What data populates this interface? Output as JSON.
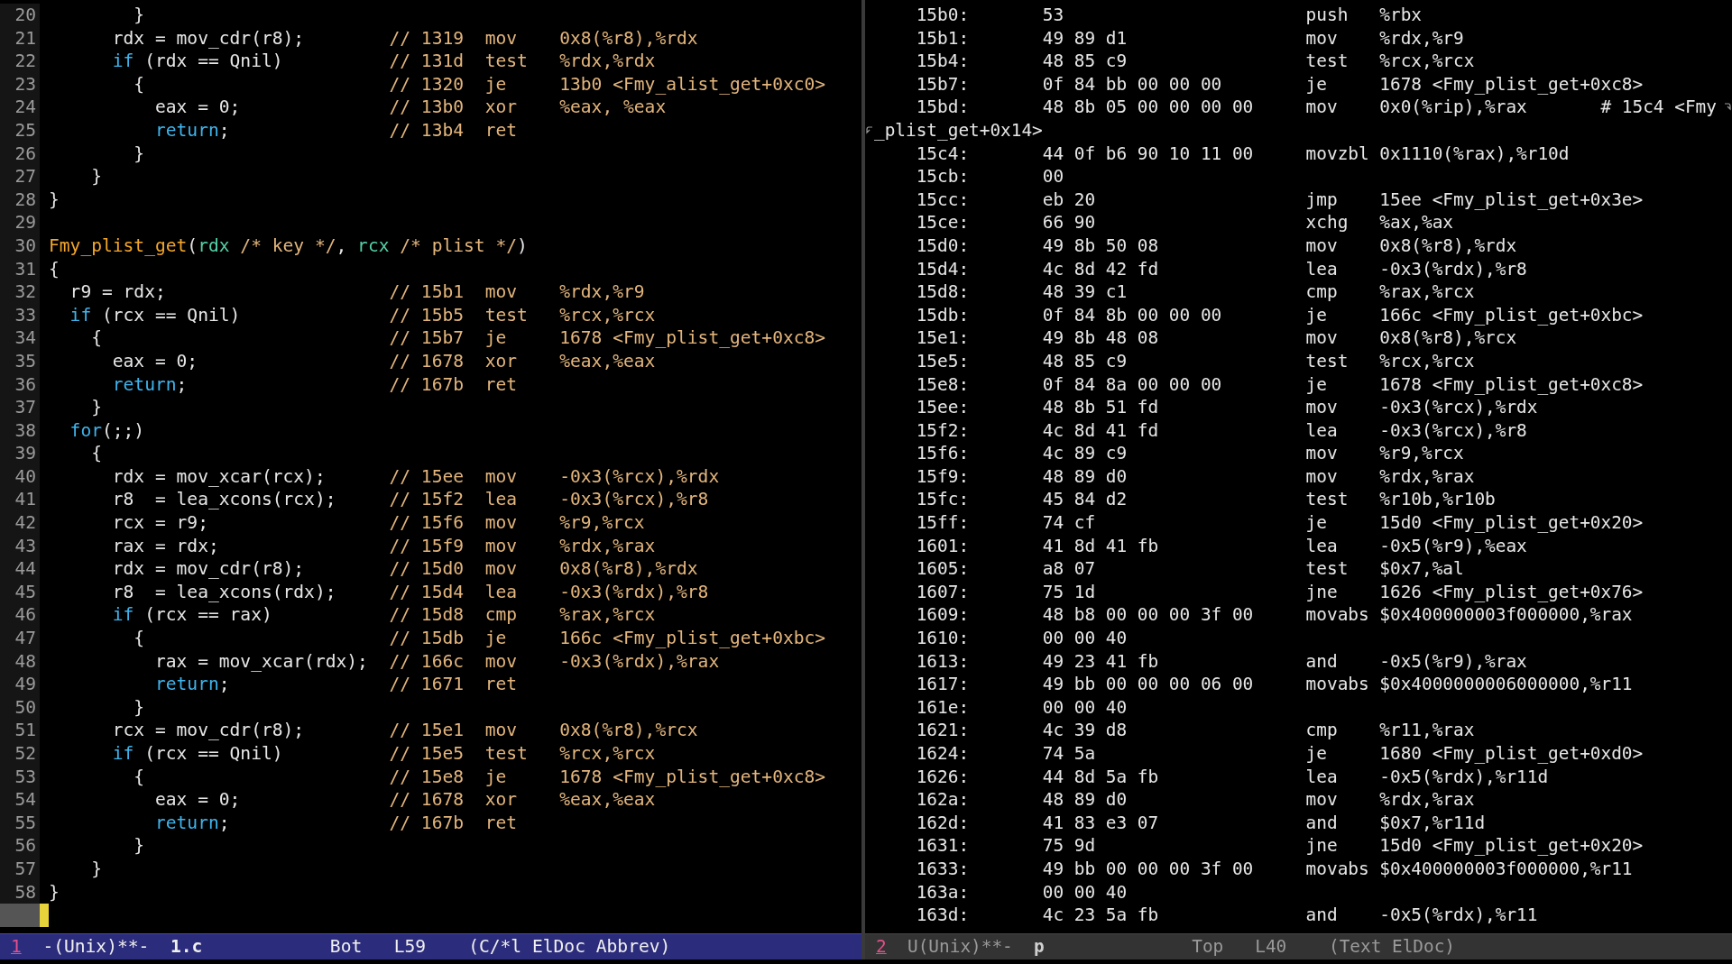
{
  "left_pane": {
    "lines": [
      {
        "number": "20",
        "segments": [
          {
            "text": "        }",
            "kind": "code"
          }
        ]
      },
      {
        "number": "21",
        "segments": [
          {
            "text": "      rdx = mov_cdr(r8);",
            "kind": "code"
          }
        ],
        "comment": "// 1319  mov    0x8(%r8),%rdx"
      },
      {
        "number": "22",
        "segments": [
          {
            "text": "      if",
            "kind": "keyword"
          },
          {
            "text": " (rdx == Qnil)",
            "kind": "code"
          }
        ],
        "comment": "// 131d  test   %rdx,%rdx"
      },
      {
        "number": "23",
        "segments": [
          {
            "text": "        {",
            "kind": "code"
          }
        ],
        "comment": "// 1320  je     13b0 <Fmy_alist_get+0xc0>"
      },
      {
        "number": "24",
        "segments": [
          {
            "text": "          eax = 0;",
            "kind": "code"
          }
        ],
        "comment": "// 13b0  xor    %eax, %eax"
      },
      {
        "number": "25",
        "segments": [
          {
            "text": "          return",
            "kind": "keyword"
          },
          {
            "text": ";",
            "kind": "code"
          }
        ],
        "comment": "// 13b4  ret"
      },
      {
        "number": "26",
        "segments": [
          {
            "text": "        }",
            "kind": "code"
          }
        ]
      },
      {
        "number": "27",
        "segments": [
          {
            "text": "    }",
            "kind": "code"
          }
        ]
      },
      {
        "number": "28",
        "segments": [
          {
            "text": "}",
            "kind": "code"
          }
        ]
      },
      {
        "number": "29"
      },
      {
        "number": "30",
        "segments": [
          {
            "text": "Fmy_plist_get",
            "kind": "function"
          },
          {
            "text": "(",
            "kind": "code"
          },
          {
            "text": "rdx",
            "kind": "param"
          },
          {
            "text": " /* key */",
            "kind": "comment"
          },
          {
            "text": ", ",
            "kind": "code"
          },
          {
            "text": "rcx",
            "kind": "param"
          },
          {
            "text": " /* plist */",
            "kind": "comment"
          },
          {
            "text": ")",
            "kind": "code"
          }
        ]
      },
      {
        "number": "31",
        "segments": [
          {
            "text": "{",
            "kind": "code"
          }
        ]
      },
      {
        "number": "32",
        "segments": [
          {
            "text": "  r9 = rdx;",
            "kind": "code"
          }
        ],
        "comment": "// 15b1  mov    %rdx,%r9"
      },
      {
        "number": "33",
        "segments": [
          {
            "text": "  if",
            "kind": "keyword"
          },
          {
            "text": " (rcx == Qnil)",
            "kind": "code"
          }
        ],
        "comment": "// 15b5  test   %rcx,%rcx"
      },
      {
        "number": "34",
        "segments": [
          {
            "text": "    {",
            "kind": "code"
          }
        ],
        "comment": "// 15b7  je     1678 <Fmy_plist_get+0xc8>"
      },
      {
        "number": "35",
        "segments": [
          {
            "text": "      eax = 0;",
            "kind": "code"
          }
        ],
        "comment": "// 1678  xor    %eax,%eax"
      },
      {
        "number": "36",
        "segments": [
          {
            "text": "      return",
            "kind": "keyword"
          },
          {
            "text": ";",
            "kind": "code"
          }
        ],
        "comment": "// 167b  ret"
      },
      {
        "number": "37",
        "segments": [
          {
            "text": "    }",
            "kind": "code"
          }
        ]
      },
      {
        "number": "38",
        "segments": [
          {
            "text": "  for",
            "kind": "keyword"
          },
          {
            "text": "(;;)",
            "kind": "code"
          }
        ]
      },
      {
        "number": "39",
        "segments": [
          {
            "text": "    {",
            "kind": "code"
          }
        ]
      },
      {
        "number": "40",
        "segments": [
          {
            "text": "      rdx = mov_xcar(rcx);",
            "kind": "code"
          }
        ],
        "comment": "// 15ee  mov    -0x3(%rcx),%rdx"
      },
      {
        "number": "41",
        "segments": [
          {
            "text": "      r8  = lea_xcons(rcx);",
            "kind": "code"
          }
        ],
        "comment": "// 15f2  lea    -0x3(%rcx),%r8"
      },
      {
        "number": "42",
        "segments": [
          {
            "text": "      rcx = r9;",
            "kind": "code"
          }
        ],
        "comment": "// 15f6  mov    %r9,%rcx"
      },
      {
        "number": "43",
        "segments": [
          {
            "text": "      rax = rdx;",
            "kind": "code"
          }
        ],
        "comment": "// 15f9  mov    %rdx,%rax"
      },
      {
        "number": "44",
        "segments": [
          {
            "text": "      rdx = mov_cdr(r8);",
            "kind": "code"
          }
        ],
        "comment": "// 15d0  mov    0x8(%r8),%rdx"
      },
      {
        "number": "45",
        "segments": [
          {
            "text": "      r8  = lea_xcons(rdx);",
            "kind": "code"
          }
        ],
        "comment": "// 15d4  lea    -0x3(%rdx),%r8"
      },
      {
        "number": "46",
        "segments": [
          {
            "text": "      if",
            "kind": "keyword"
          },
          {
            "text": " (rcx == rax)",
            "kind": "code"
          }
        ],
        "comment": "// 15d8  cmp    %rax,%rcx"
      },
      {
        "number": "47",
        "segments": [
          {
            "text": "        {",
            "kind": "code"
          }
        ],
        "comment": "// 15db  je     166c <Fmy_plist_get+0xbc>"
      },
      {
        "number": "48",
        "segments": [
          {
            "text": "          rax = mov_xcar(rdx);",
            "kind": "code"
          }
        ],
        "comment": "// 166c  mov    -0x3(%rdx),%rax"
      },
      {
        "number": "49",
        "segments": [
          {
            "text": "          return",
            "kind": "keyword"
          },
          {
            "text": ";",
            "kind": "code"
          }
        ],
        "comment": "// 1671  ret"
      },
      {
        "number": "50",
        "segments": [
          {
            "text": "        }",
            "kind": "code"
          }
        ]
      },
      {
        "number": "51",
        "segments": [
          {
            "text": "      rcx = mov_cdr(r8);",
            "kind": "code"
          }
        ],
        "comment": "// 15e1  mov    0x8(%r8),%rcx"
      },
      {
        "number": "52",
        "segments": [
          {
            "text": "      if",
            "kind": "keyword"
          },
          {
            "text": " (rcx == Qnil)",
            "kind": "code"
          }
        ],
        "comment": "// 15e5  test   %rcx,%rcx"
      },
      {
        "number": "53",
        "segments": [
          {
            "text": "        {",
            "kind": "code"
          }
        ],
        "comment": "// 15e8  je     1678 <Fmy_plist_get+0xc8>"
      },
      {
        "number": "54",
        "segments": [
          {
            "text": "          eax = 0;",
            "kind": "code"
          }
        ],
        "comment": "// 1678  xor    %eax,%eax"
      },
      {
        "number": "55",
        "segments": [
          {
            "text": "          return",
            "kind": "keyword"
          },
          {
            "text": ";",
            "kind": "code"
          }
        ],
        "comment": "// 167b  ret"
      },
      {
        "number": "56",
        "segments": [
          {
            "text": "        }",
            "kind": "code"
          }
        ]
      },
      {
        "number": "57",
        "segments": [
          {
            "text": "    }",
            "kind": "code"
          }
        ]
      },
      {
        "number": "58",
        "segments": [
          {
            "text": "}",
            "kind": "code"
          }
        ]
      }
    ],
    "mode_line": {
      "window": "1",
      "status": "-(Unix)**-",
      "buffer": "1.c",
      "position": "Bot",
      "line": "L59",
      "modes": "(C/*l ElDoc Abbrev)",
      "active": true
    }
  },
  "right_pane": {
    "rows": [
      {
        "kind": "instruction",
        "address": "15b0:",
        "bytes": "53",
        "mnemonic": "push",
        "operands": "%rbx"
      },
      {
        "kind": "instruction",
        "address": "15b1:",
        "bytes": "49 89 d1",
        "mnemonic": "mov",
        "operands": "%rdx,%r9"
      },
      {
        "kind": "instruction",
        "address": "15b4:",
        "bytes": "48 85 c9",
        "mnemonic": "test",
        "operands": "%rcx,%rcx"
      },
      {
        "kind": "instruction",
        "address": "15b7:",
        "bytes": "0f 84 bb 00 00 00",
        "mnemonic": "je",
        "operands": "1678 <Fmy_plist_get+0xc8>"
      },
      {
        "kind": "instruction",
        "address": "15bd:",
        "bytes": "48 8b 05 00 00 00 00",
        "mnemonic": "mov",
        "operands": "0x0(%rip),%rax",
        "comment": "# 15c4 <Fmy",
        "wrapped": true
      },
      {
        "kind": "continuation",
        "text": "_plist_get+0x14>"
      },
      {
        "kind": "instruction",
        "address": "15c4:",
        "bytes": "44 0f b6 90 10 11 00",
        "mnemonic": "movzbl",
        "operands": "0x1110(%rax),%r10d"
      },
      {
        "kind": "instruction",
        "address": "15cb:",
        "bytes": "00"
      },
      {
        "kind": "instruction",
        "address": "15cc:",
        "bytes": "eb 20",
        "mnemonic": "jmp",
        "operands": "15ee <Fmy_plist_get+0x3e>"
      },
      {
        "kind": "instruction",
        "address": "15ce:",
        "bytes": "66 90",
        "mnemonic": "xchg",
        "operands": "%ax,%ax"
      },
      {
        "kind": "instruction",
        "address": "15d0:",
        "bytes": "49 8b 50 08",
        "mnemonic": "mov",
        "operands": "0x8(%r8),%rdx"
      },
      {
        "kind": "instruction",
        "address": "15d4:",
        "bytes": "4c 8d 42 fd",
        "mnemonic": "lea",
        "operands": "-0x3(%rdx),%r8"
      },
      {
        "kind": "instruction",
        "address": "15d8:",
        "bytes": "48 39 c1",
        "mnemonic": "cmp",
        "operands": "%rax,%rcx"
      },
      {
        "kind": "instruction",
        "address": "15db:",
        "bytes": "0f 84 8b 00 00 00",
        "mnemonic": "je",
        "operands": "166c <Fmy_plist_get+0xbc>"
      },
      {
        "kind": "instruction",
        "address": "15e1:",
        "bytes": "49 8b 48 08",
        "mnemonic": "mov",
        "operands": "0x8(%r8),%rcx"
      },
      {
        "kind": "instruction",
        "address": "15e5:",
        "bytes": "48 85 c9",
        "mnemonic": "test",
        "operands": "%rcx,%rcx"
      },
      {
        "kind": "instruction",
        "address": "15e8:",
        "bytes": "0f 84 8a 00 00 00",
        "mnemonic": "je",
        "operands": "1678 <Fmy_plist_get+0xc8>"
      },
      {
        "kind": "instruction",
        "address": "15ee:",
        "bytes": "48 8b 51 fd",
        "mnemonic": "mov",
        "operands": "-0x3(%rcx),%rdx"
      },
      {
        "kind": "instruction",
        "address": "15f2:",
        "bytes": "4c 8d 41 fd",
        "mnemonic": "lea",
        "operands": "-0x3(%rcx),%r8"
      },
      {
        "kind": "instruction",
        "address": "15f6:",
        "bytes": "4c 89 c9",
        "mnemonic": "mov",
        "operands": "%r9,%rcx"
      },
      {
        "kind": "instruction",
        "address": "15f9:",
        "bytes": "48 89 d0",
        "mnemonic": "mov",
        "operands": "%rdx,%rax"
      },
      {
        "kind": "instruction",
        "address": "15fc:",
        "bytes": "45 84 d2",
        "mnemonic": "test",
        "operands": "%r10b,%r10b"
      },
      {
        "kind": "instruction",
        "address": "15ff:",
        "bytes": "74 cf",
        "mnemonic": "je",
        "operands": "15d0 <Fmy_plist_get+0x20>"
      },
      {
        "kind": "instruction",
        "address": "1601:",
        "bytes": "41 8d 41 fb",
        "mnemonic": "lea",
        "operands": "-0x5(%r9),%eax"
      },
      {
        "kind": "instruction",
        "address": "1605:",
        "bytes": "a8 07",
        "mnemonic": "test",
        "operands": "$0x7,%al"
      },
      {
        "kind": "instruction",
        "address": "1607:",
        "bytes": "75 1d",
        "mnemonic": "jne",
        "operands": "1626 <Fmy_plist_get+0x76>"
      },
      {
        "kind": "instruction",
        "address": "1609:",
        "bytes": "48 b8 00 00 00 3f 00",
        "mnemonic": "movabs",
        "operands": "$0x400000003f000000,%rax"
      },
      {
        "kind": "instruction",
        "address": "1610:",
        "bytes": "00 00 40"
      },
      {
        "kind": "instruction",
        "address": "1613:",
        "bytes": "49 23 41 fb",
        "mnemonic": "and",
        "operands": "-0x5(%r9),%rax"
      },
      {
        "kind": "instruction",
        "address": "1617:",
        "bytes": "49 bb 00 00 00 06 00",
        "mnemonic": "movabs",
        "operands": "$0x4000000006000000,%r11"
      },
      {
        "kind": "instruction",
        "address": "161e:",
        "bytes": "00 00 40"
      },
      {
        "kind": "instruction",
        "address": "1621:",
        "bytes": "4c 39 d8",
        "mnemonic": "cmp",
        "operands": "%r11,%rax"
      },
      {
        "kind": "instruction",
        "address": "1624:",
        "bytes": "74 5a",
        "mnemonic": "je",
        "operands": "1680 <Fmy_plist_get+0xd0>"
      },
      {
        "kind": "instruction",
        "address": "1626:",
        "bytes": "44 8d 5a fb",
        "mnemonic": "lea",
        "operands": "-0x5(%rdx),%r11d"
      },
      {
        "kind": "instruction",
        "address": "162a:",
        "bytes": "48 89 d0",
        "mnemonic": "mov",
        "operands": "%rdx,%rax"
      },
      {
        "kind": "instruction",
        "address": "162d:",
        "bytes": "41 83 e3 07",
        "mnemonic": "and",
        "operands": "$0x7,%r11d"
      },
      {
        "kind": "instruction",
        "address": "1631:",
        "bytes": "75 9d",
        "mnemonic": "jne",
        "operands": "15d0 <Fmy_plist_get+0x20>"
      },
      {
        "kind": "instruction",
        "address": "1633:",
        "bytes": "49 bb 00 00 00 3f 00",
        "mnemonic": "movabs",
        "operands": "$0x400000003f000000,%r11"
      },
      {
        "kind": "instruction",
        "address": "163a:",
        "bytes": "00 00 40"
      },
      {
        "kind": "instruction",
        "address": "163d:",
        "bytes": "4c 23 5a fb",
        "mnemonic": "and",
        "operands": "-0x5(%rdx),%r11"
      }
    ],
    "mode_line": {
      "window": "2",
      "status": "U(Unix)**-",
      "buffer": "p",
      "position": "Top",
      "line": "L40",
      "modes": "(Text ElDoc)",
      "active": false
    }
  }
}
